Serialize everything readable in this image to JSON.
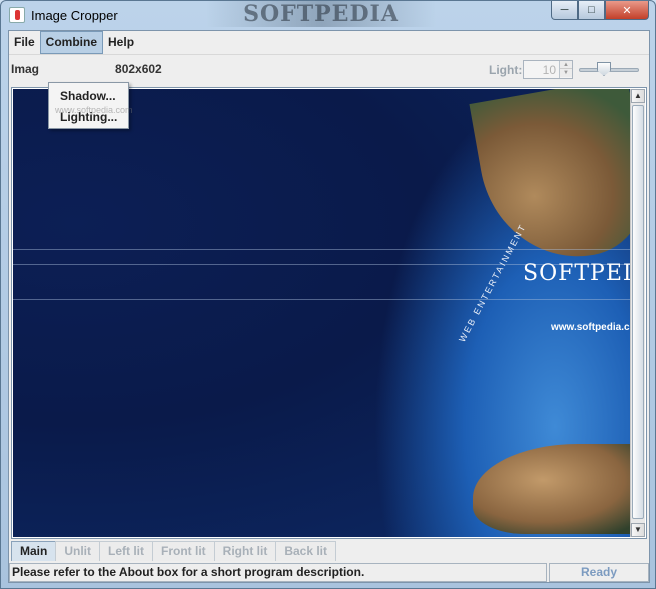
{
  "window": {
    "title": "Image Cropper",
    "watermark": "SOFTPEDIA",
    "controls": {
      "minimize": "─",
      "maximize": "□",
      "close": "✕"
    }
  },
  "menubar": {
    "items": [
      "File",
      "Combine",
      "Help"
    ],
    "active": "Combine"
  },
  "combine_menu": {
    "items": [
      "Shadow...",
      "Lighting..."
    ],
    "ghost_text": "www.softpedia.com"
  },
  "toolbar": {
    "image_label": "Imag",
    "image_size": "802x602",
    "light_label": "Light:",
    "light_value": "10",
    "slider_level": 0.4
  },
  "image": {
    "brand_text": "SOFTPEDI",
    "url_text": "www.softpedia.c",
    "tagline": "WEB   ENTERTAINMENT"
  },
  "tabs": {
    "items": [
      "Main",
      "Unlit",
      "Left lit",
      "Front lit",
      "Right lit",
      "Back lit"
    ],
    "active": "Main"
  },
  "status": {
    "message": "Please refer to the About box for a short program description.",
    "state": "Ready"
  },
  "icons": {
    "app": "cup-icon",
    "scroll_up": "▲",
    "scroll_down": "▼",
    "spin_up": "▲",
    "spin_down": "▼"
  }
}
